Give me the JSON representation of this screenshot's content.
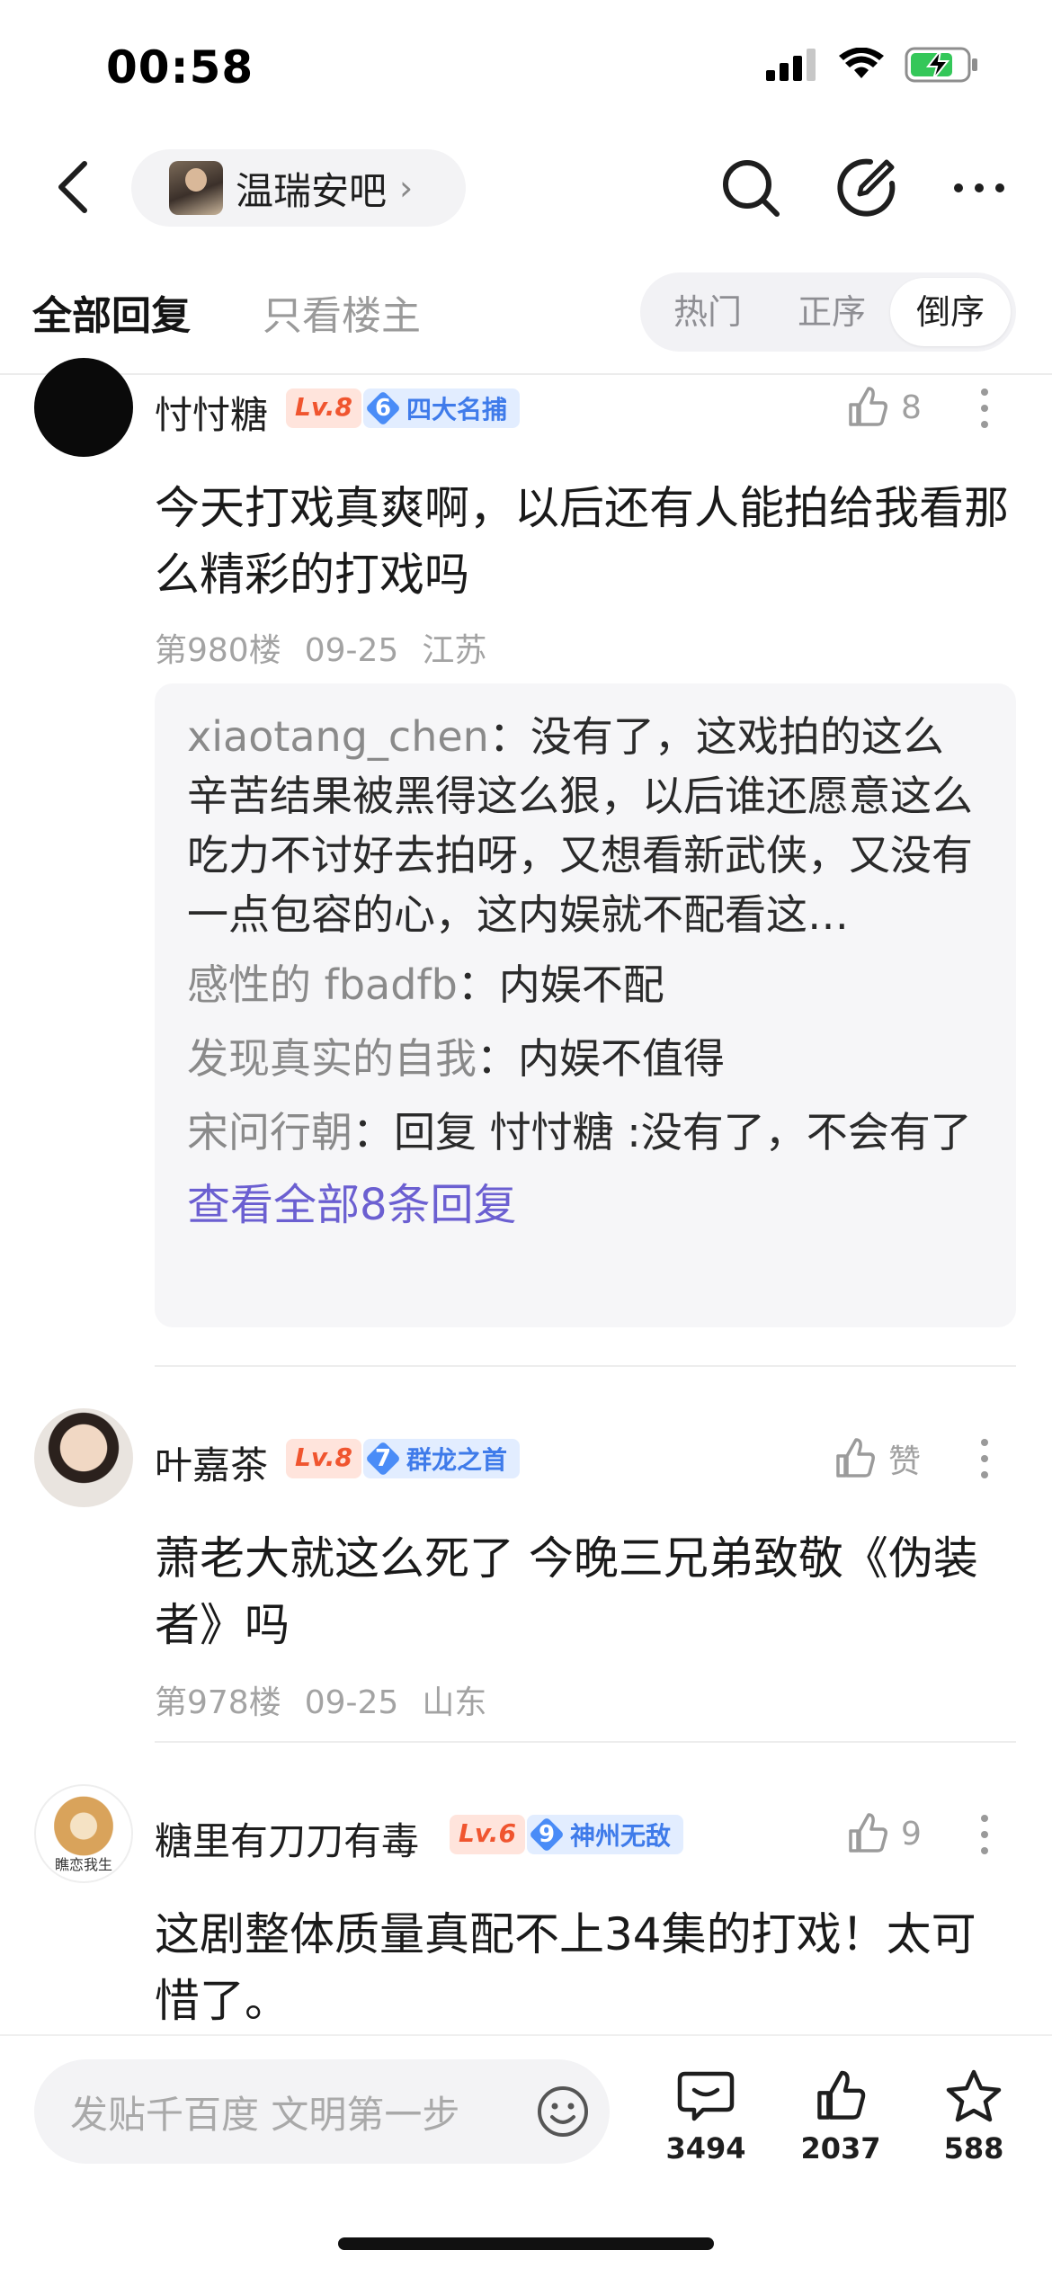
{
  "status_bar": {
    "time": "00:58"
  },
  "nav": {
    "forum_name": "温瑞安吧",
    "forum_chevron": "›"
  },
  "tabs": {
    "all_replies": "全部回复",
    "only_op": "只看楼主"
  },
  "sort": {
    "hot": "热门",
    "asc": "正序",
    "desc": "倒序",
    "active": "desc"
  },
  "posts": [
    {
      "username": "忖忖糖",
      "level": "Lv.8",
      "rank_num": "6",
      "rank_title": "四大名捕",
      "likes": "8",
      "content": "今天打戏真爽啊，以后还有人能拍给我看那么精彩的打戏吗",
      "floor": "第980楼",
      "date": "09-25",
      "location": "江苏",
      "replies": [
        {
          "user": "xiaotang_chen",
          "sep": "：",
          "text": "没有了，这戏拍的这么辛苦结果被黑得这么狠，以后谁还愿意这么吃力不讨好去拍呀，又想看新武侠，又没有一点包容的心，这内娱就不配看这…"
        },
        {
          "user": "感性的 fbadfb",
          "sep": "：",
          "text": "内娱不配"
        },
        {
          "user": "发现真实的自我",
          "sep": "：",
          "text": "内娱不值得"
        },
        {
          "user": "宋问行朝",
          "sep": "：",
          "text": "回复 忖忖糖 :没有了，不会有了"
        }
      ],
      "view_all": "查看全部8条回复"
    },
    {
      "username": "叶嘉茶",
      "level": "Lv.8",
      "rank_num": "7",
      "rank_title": "群龙之首",
      "likes": "赞",
      "content": "萧老大就这么死了 今晚三兄弟致敬《伪装者》吗",
      "floor": "第978楼",
      "date": "09-25",
      "location": "山东"
    },
    {
      "username": "糖里有刀刀有毒",
      "level": "Lv.6",
      "rank_num": "9",
      "rank_title": "神州无敌",
      "likes": "9",
      "content": "这剧整体质量真配不上34集的打戏！太可惜了。",
      "avatar_caption": "瞧恋我生"
    }
  ],
  "bottom_bar": {
    "input_placeholder": "发贴千百度 文明第一步",
    "comments": "3494",
    "likes": "2037",
    "favorites": "588"
  },
  "colors": {
    "level_badge": "#f0552f",
    "rank_badge": "#4a8cf7",
    "view_all_link": "#6b5fd1"
  }
}
